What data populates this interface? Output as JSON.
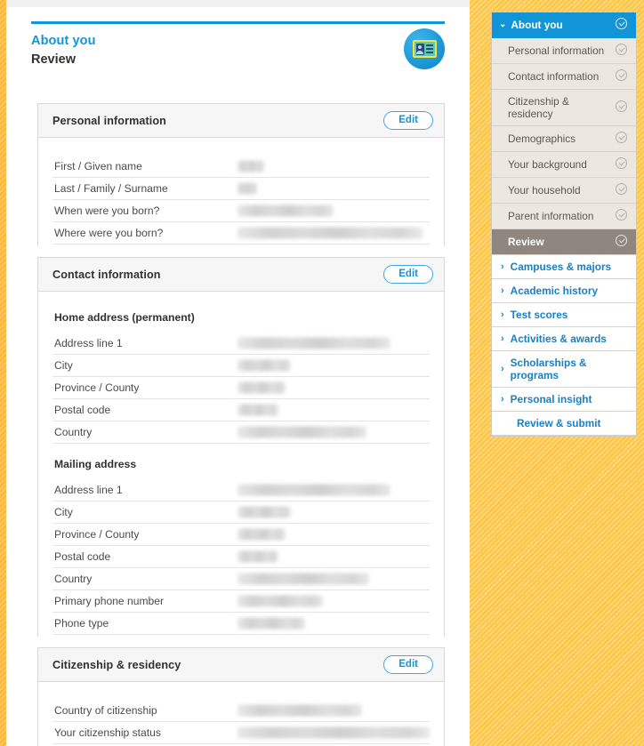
{
  "header": {
    "eyebrow": "About you",
    "title": "Review",
    "badge_icon": "id-card-icon"
  },
  "cards": [
    {
      "title": "Personal information",
      "edit_label": "Edit",
      "groups": [
        {
          "subhead": null,
          "rows": [
            {
              "label": "First / Given name",
              "value_redacted": true,
              "blob_width": 30
            },
            {
              "label": "Last / Family / Surname",
              "value_redacted": true,
              "blob_width": 22
            },
            {
              "label": "When were you born?",
              "value_redacted": true,
              "blob_width": 108
            },
            {
              "label": "Where were you born?",
              "value_redacted": true,
              "blob_width": 208
            }
          ]
        }
      ]
    },
    {
      "title": "Contact information",
      "edit_label": "Edit",
      "groups": [
        {
          "subhead": "Home address (permanent)",
          "rows": [
            {
              "label": "Address line 1",
              "value_redacted": true,
              "blob_width": 172
            },
            {
              "label": "City",
              "value_redacted": true,
              "blob_width": 60
            },
            {
              "label": "Province / County",
              "value_redacted": true,
              "blob_width": 54
            },
            {
              "label": "Postal code",
              "value_redacted": true,
              "blob_width": 46
            },
            {
              "label": "Country",
              "value_redacted": true,
              "blob_width": 145
            }
          ]
        },
        {
          "subhead": "Mailing address",
          "rows": [
            {
              "label": "Address line 1",
              "value_redacted": true,
              "blob_width": 172
            },
            {
              "label": "City",
              "value_redacted": true,
              "blob_width": 60
            },
            {
              "label": "Province / County",
              "value_redacted": true,
              "blob_width": 54
            },
            {
              "label": "Postal code",
              "value_redacted": true,
              "blob_width": 46
            },
            {
              "label": "Country",
              "value_redacted": true,
              "blob_width": 148
            },
            {
              "label": "Primary phone number",
              "value_redacted": true,
              "blob_width": 96
            },
            {
              "label": "Phone type",
              "value_redacted": true,
              "blob_width": 76
            }
          ]
        }
      ]
    },
    {
      "title": "Citizenship & residency",
      "edit_label": "Edit",
      "groups": [
        {
          "subhead": null,
          "rows": [
            {
              "label": "Country of citizenship",
              "value_redacted": true,
              "blob_width": 140
            },
            {
              "label": "Your citizenship status",
              "value_redacted": true,
              "blob_width": 216
            }
          ]
        }
      ]
    }
  ],
  "sidebar": {
    "items": [
      {
        "label": "About you",
        "style": "group-active",
        "icon": "check-circle-icon",
        "chevron": "chevron-down-icon"
      },
      {
        "label": "Personal information",
        "style": "sub",
        "icon": "check-circle-icon"
      },
      {
        "label": "Contact information",
        "style": "sub",
        "icon": "check-circle-icon"
      },
      {
        "label": "Citizenship & residency",
        "style": "sub",
        "icon": "check-circle-icon"
      },
      {
        "label": "Demographics",
        "style": "sub",
        "icon": "check-circle-icon"
      },
      {
        "label": "Your background",
        "style": "sub",
        "icon": "check-circle-icon"
      },
      {
        "label": "Your household",
        "style": "sub",
        "icon": "check-circle-icon"
      },
      {
        "label": "Parent information",
        "style": "sub",
        "icon": "check-circle-icon"
      },
      {
        "label": "Review",
        "style": "sub current",
        "icon": "check-circle-icon"
      },
      {
        "label": "Campuses & majors",
        "style": "link",
        "chevron": "chevron-right-icon"
      },
      {
        "label": "Academic history",
        "style": "link",
        "chevron": "chevron-right-icon"
      },
      {
        "label": "Test scores",
        "style": "link",
        "chevron": "chevron-right-icon"
      },
      {
        "label": "Activities & awards",
        "style": "link",
        "chevron": "chevron-right-icon"
      },
      {
        "label": "Scholarships & programs",
        "style": "link",
        "chevron": "chevron-right-icon"
      },
      {
        "label": "Personal insight",
        "style": "link",
        "chevron": "chevron-right-icon"
      },
      {
        "label": "Review & submit",
        "style": "link noarrow"
      }
    ]
  },
  "colors": {
    "accent_blue": "#1295d8",
    "brand_yellow": "#fcc440",
    "current_gray": "#8e867f",
    "sub_bg": "#ece7e1"
  }
}
